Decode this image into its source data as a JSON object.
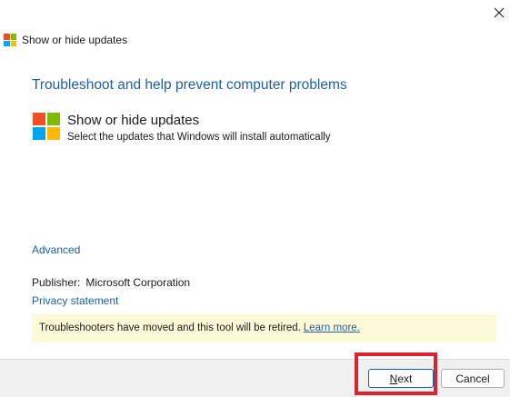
{
  "window": {
    "title": "Show or hide updates",
    "close_glyph": "✕"
  },
  "main": {
    "heading": "Troubleshoot and help prevent computer problems",
    "tool": {
      "name": "Show or hide updates",
      "description": "Select the updates that Windows will install automatically",
      "icon": "windows-logo-icon"
    },
    "advanced_link": "Advanced",
    "publisher_label": "Publisher:",
    "publisher_value": "Microsoft Corporation",
    "privacy_link": "Privacy statement",
    "notice": {
      "text": "Troubleshooters have moved and this tool will be retired.",
      "link": "Learn more."
    }
  },
  "footer": {
    "next_label_first": "N",
    "next_label_rest": "ext",
    "cancel_label": "Cancel"
  },
  "colors": {
    "link": "#1f5fa8",
    "notice_bg": "#fdfbd7",
    "highlight": "#d9232e",
    "logo_red": "#f25022",
    "logo_green": "#7fba00",
    "logo_blue": "#00a4ef",
    "logo_yellow": "#ffb900"
  }
}
